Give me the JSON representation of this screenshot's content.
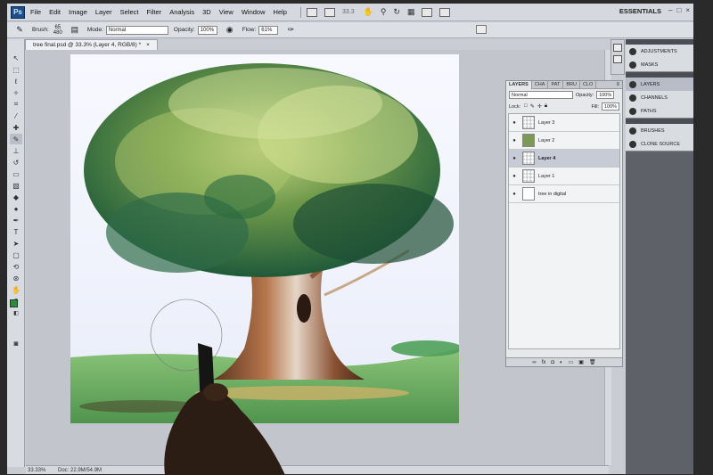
{
  "menubar": {
    "logo": "Ps",
    "items": [
      "File",
      "Edit",
      "Image",
      "Layer",
      "Select",
      "Filter",
      "Analysis",
      "3D",
      "View",
      "Window",
      "Help"
    ],
    "zoom": "33.3",
    "workspace": "ESSENTIALS"
  },
  "optbar": {
    "brush_label": "Brush:",
    "brush_size": "65",
    "brush_size2": "480",
    "mode_label": "Mode:",
    "mode_value": "Normal",
    "opacity_label": "Opacity:",
    "opacity_value": "100%",
    "flow_label": "Flow:",
    "flow_value": "61%"
  },
  "document": {
    "tab_title": "tree final.psd @ 33.3% (Layer 4, RGB/8) *",
    "status_zoom": "33.33%",
    "status_doc": "Doc: 22.9M/54.9M"
  },
  "layers_panel": {
    "tabs": [
      "LAYERS",
      "CHA",
      "PAT",
      "BRU",
      "CLO"
    ],
    "blend_mode": "Normal",
    "opacity_label": "Opacity:",
    "opacity_value": "100%",
    "lock_label": "Lock:",
    "fill_label": "Fill:",
    "fill_value": "100%",
    "layers": [
      {
        "name": "Layer 3",
        "selected": false,
        "thumb": "trans"
      },
      {
        "name": "Layer 2",
        "selected": false,
        "thumb": "tree"
      },
      {
        "name": "Layer 4",
        "selected": true,
        "thumb": "trans"
      },
      {
        "name": "Layer 1",
        "selected": false,
        "thumb": "trans"
      },
      {
        "name": "tree in digital",
        "selected": false,
        "thumb": "white"
      }
    ]
  },
  "dock": {
    "group1": [
      "ADJUSTMENTS",
      "MASKS"
    ],
    "group2": [
      "LAYERS",
      "CHANNELS",
      "PATHS"
    ],
    "group3": [
      "BRUSHES",
      "CLONE SOURCE"
    ]
  },
  "colors": {
    "foreground": "#2c8a3a",
    "selected_layer": "#c7cbd6"
  }
}
